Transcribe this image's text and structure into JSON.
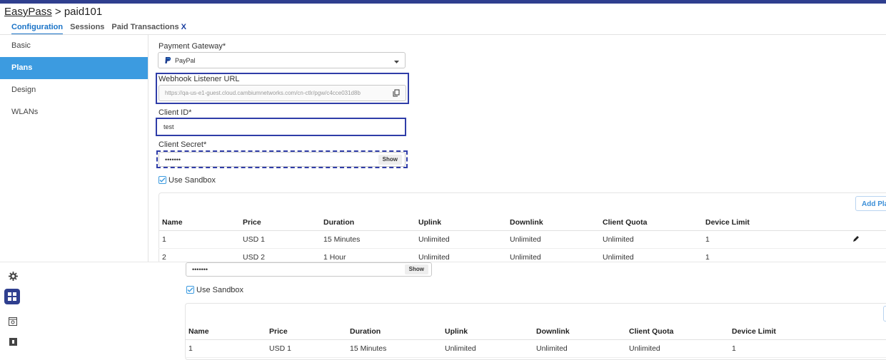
{
  "breadcrumb": {
    "root": "EasyPass",
    "separator": " > ",
    "current": "paid101"
  },
  "tabs": [
    {
      "label": "Configuration",
      "active": true
    },
    {
      "label": "Sessions",
      "active": false
    },
    {
      "label": "Paid Transactions",
      "active": false,
      "suffix": "X"
    }
  ],
  "sidebar": {
    "items": [
      {
        "label": "Basic",
        "active": false
      },
      {
        "label": "Plans",
        "active": true
      },
      {
        "label": "Design",
        "active": false
      },
      {
        "label": "WLANs",
        "active": false
      }
    ]
  },
  "form": {
    "payment_gateway_label": "Payment Gateway*",
    "payment_gateway_value": "PayPal",
    "webhook_label": "Webhook Listener URL",
    "webhook_value": "https://qa-us-e1-guest.cloud.cambiumnetworks.com/cn-ctlr/pgw/c4cce031d8b",
    "client_id_label": "Client ID*",
    "client_id_value": "test",
    "client_secret_label": "Client Secret*",
    "client_secret_value": "•••••••",
    "show_label": "Show",
    "sandbox_label": "Use Sandbox",
    "sandbox_checked": true
  },
  "plans": {
    "add_button": "Add Plan",
    "columns": [
      "Name",
      "Price",
      "Duration",
      "Uplink",
      "Downlink",
      "Client Quota",
      "Device Limit"
    ],
    "rows": [
      [
        "1",
        "USD 1",
        "15 Minutes",
        "Unlimited",
        "Unlimited",
        "Unlimited",
        "1"
      ],
      [
        "2",
        "USD 2",
        "1 Hour",
        "Unlimited",
        "Unlimited",
        "Unlimited",
        "1"
      ]
    ]
  },
  "rail_icons": [
    "gear-icon",
    "dashboard-icon",
    "camera-box-icon",
    "square-box-icon"
  ],
  "colors": {
    "accent": "#3c9be0",
    "highlight": "#2f3da8",
    "topbar": "#2f3f8f"
  }
}
